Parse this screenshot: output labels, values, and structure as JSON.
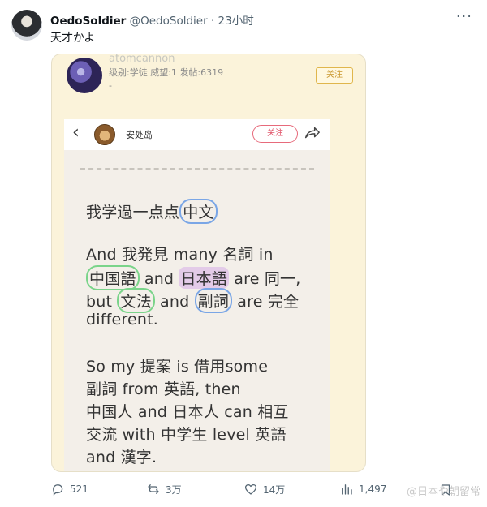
{
  "tweet": {
    "display_name": "OedoSoldier",
    "handle": "@OedoSoldier",
    "time": "· 23小时",
    "text": "天才かよ",
    "more_label": "···"
  },
  "embedded_post": {
    "username": "atomcannon",
    "meta": "级别:学徒 威望:1 发帖:6319",
    "dash": "-",
    "follow_label": "关注",
    "board_name": "安处岛",
    "board_follow_label": "关注",
    "lines": [
      "我学過一点点中文",
      "And 我発見 many 名詞 in",
      "中国語 and 日本語 are 同一,",
      "but 文法 and 副詞 are 完全",
      "different.",
      "So my 提案 is 借用some",
      "副詞 from 英語, then",
      "中国人 and 日本人 can 相互",
      "交流 with 中学生 level 英語",
      "and 漢字."
    ],
    "highlights": {
      "l1_pre": "我学過一点点",
      "l1_circle": "中文",
      "l3_a": "中国語",
      "l3_b": " and ",
      "l3_c": "日本語",
      "l3_d": " are 同一,",
      "l4_a": "but ",
      "l4_b": "文法",
      "l4_c": " and ",
      "l4_d": "副詞",
      "l4_e": " are  完全"
    }
  },
  "actions": {
    "replies": "521",
    "retweets": "3万",
    "likes": "14万",
    "views": "1,497"
  },
  "watermark": "@日本や朝留常",
  "colors": {
    "media_bg": "#fbf3da",
    "circle_blue": "#7aa6e6",
    "circle_green": "#7ad48a",
    "highlight_purple": "#d6ade8",
    "follow_red": "#e0566b"
  }
}
